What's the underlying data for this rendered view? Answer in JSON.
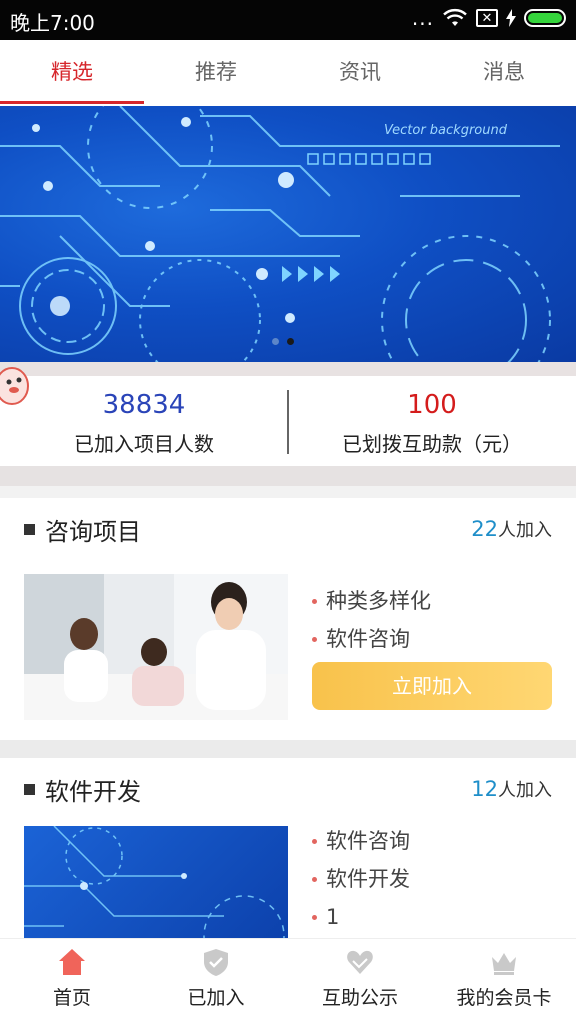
{
  "status_bar": {
    "time": "晚上7:00",
    "dots": "..."
  },
  "tabs": [
    {
      "label": "精选",
      "active": true
    },
    {
      "label": "推荐",
      "active": false
    },
    {
      "label": "资讯",
      "active": false
    },
    {
      "label": "消息",
      "active": false
    }
  ],
  "banner": {
    "text": "Vector background",
    "slides": 2,
    "current": 2
  },
  "stats": {
    "members": {
      "value": "38834",
      "label": "已加入项目人数"
    },
    "funds": {
      "value": "100",
      "label": "已划拨互助款（元）"
    }
  },
  "cards": [
    {
      "title": "咨询项目",
      "joined_count": "22",
      "joined_suffix": "人加入",
      "bullets": [
        "种类多样化",
        "软件咨询"
      ],
      "button": "立即加入"
    },
    {
      "title": "软件开发",
      "joined_count": "12",
      "joined_suffix": "人加入",
      "bullets": [
        "软件咨询",
        "软件开发",
        "1"
      ]
    }
  ],
  "bottom_nav": [
    {
      "label": "首页",
      "icon": "home-icon",
      "active": true
    },
    {
      "label": "已加入",
      "icon": "shield-check-icon",
      "active": false
    },
    {
      "label": "互助公示",
      "icon": "heart-hands-icon",
      "active": false
    },
    {
      "label": "我的会员卡",
      "icon": "crown-icon",
      "active": false
    }
  ],
  "colors": {
    "accent_red": "#d6262b",
    "count_blue": "#1e8ec9",
    "button_yellow": "#f8c24b",
    "home_icon": "#f0645a"
  }
}
